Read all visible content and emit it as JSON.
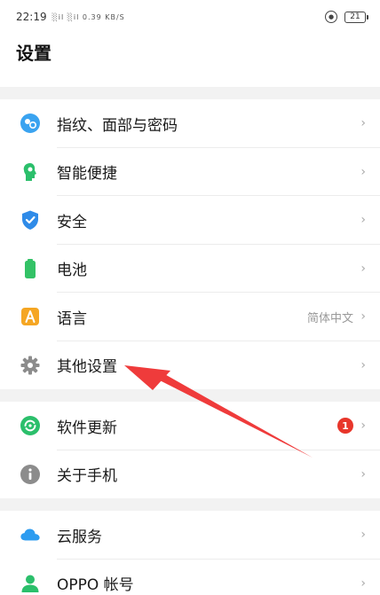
{
  "status_bar": {
    "time": "22:19",
    "signals": "░il ░il 0.39 KB/S",
    "battery": "21"
  },
  "page_title": "设置",
  "groups": [
    {
      "items": [
        {
          "label": "指纹、面部与密码",
          "icon": "fingerprint-face-icon",
          "color": "#3aa3f0"
        },
        {
          "label": "智能便捷",
          "icon": "smart-assist-icon",
          "color": "#2bbf6b"
        },
        {
          "label": "安全",
          "icon": "shield-icon",
          "color": "#2f8be8"
        },
        {
          "label": "电池",
          "icon": "battery-icon",
          "color": "#33c266"
        },
        {
          "label": "语言",
          "value": "简体中文",
          "icon": "language-icon",
          "color": "#f5a623"
        },
        {
          "label": "其他设置",
          "icon": "gear-icon",
          "color": "#8c8c8c"
        }
      ]
    },
    {
      "items": [
        {
          "label": "软件更新",
          "badge": "1",
          "icon": "update-icon",
          "color": "#2bbf6b"
        },
        {
          "label": "关于手机",
          "icon": "info-icon",
          "color": "#8c8c8c"
        }
      ]
    },
    {
      "items": [
        {
          "label": "云服务",
          "icon": "cloud-icon",
          "color": "#2d9cf0"
        },
        {
          "label": "OPPO 帐号",
          "icon": "account-icon",
          "color": "#2bbf6b"
        }
      ]
    }
  ],
  "chevron": "›",
  "annotation_arrow_color": "#ef3b3b"
}
